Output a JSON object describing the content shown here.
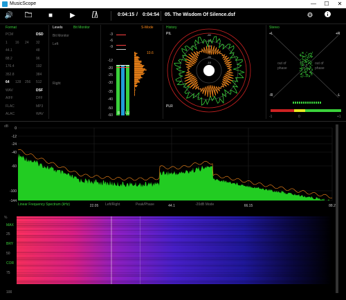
{
  "window": {
    "title": "MusicScope",
    "controls": [
      "—",
      "☐",
      "✕"
    ]
  },
  "toolbar": {
    "time_current": "0:04:15",
    "time_sep": "/",
    "time_total": "0:04:54",
    "track": "05. The Wisdom Of Silence.dsf"
  },
  "format": {
    "title": "Format",
    "rows": [
      [
        "PCM",
        "",
        "",
        "DSD"
      ],
      [
        "1",
        "16",
        "24",
        "32"
      ],
      [
        "44.1",
        "",
        "",
        "48"
      ],
      [
        "88.2",
        "",
        "",
        "96"
      ],
      [
        "176.4",
        "",
        "",
        "192"
      ],
      [
        "352.8",
        "",
        "",
        "384"
      ],
      [
        "64",
        "128",
        "256",
        "512"
      ],
      [
        "WAV",
        "",
        "",
        "DSF"
      ],
      [
        "AIFF",
        "",
        "",
        "DFF"
      ],
      [
        "FLAC",
        "",
        "",
        "MP3"
      ],
      [
        "ALAC",
        "",
        "",
        "WAV"
      ]
    ]
  },
  "levels": {
    "title": "Levels",
    "bitmonitor": "Bit Monitor",
    "bitmonitor_sub": "Bit Monitor",
    "left": "Left",
    "right": "Right"
  },
  "smode": {
    "title": "S-Mode",
    "scale": [
      "-3",
      "-6",
      "-9",
      "-12",
      "-20",
      "-25",
      "-30",
      "-35",
      "-40",
      "-50",
      "-60"
    ],
    "value": "10.6",
    "ch_l": "R",
    "ch_r": "LU"
  },
  "history": {
    "title": "History",
    "pll": "PIL",
    "plr": "PLR",
    "rings": [
      "-10",
      "-20",
      "-30",
      "-40",
      "-50",
      "-60"
    ]
  },
  "stereo": {
    "title": "Stereo",
    "corners": [
      "+L",
      "+R",
      "-R",
      "-L"
    ],
    "out_of_phase_left": "out of phase",
    "out_of_phase_right": "out of phase",
    "scale": [
      "-1",
      "0",
      "+1"
    ]
  },
  "spectrum": {
    "dB_label": "dB",
    "y_ticks": [
      "0",
      "-12",
      "-24",
      "-40",
      "-60",
      "-100",
      "-144"
    ],
    "x_title": "Linear Frequency Spectrum (kHz)",
    "x_ticks": [
      "22.05",
      "44.1",
      "66.15",
      "88.2"
    ],
    "modes": [
      "Left/Right",
      "Peak/Phase",
      "-20dB Mode"
    ]
  },
  "spectrogram": {
    "pct_label": "%",
    "y_labels": [
      "MAX",
      "25",
      "BRY",
      "50",
      "COR",
      "75",
      "100"
    ]
  },
  "colors": {
    "accent_green": "#3bd13b",
    "accent_orange": "#ff8c1a",
    "title_blue": "#1f9bd7"
  }
}
